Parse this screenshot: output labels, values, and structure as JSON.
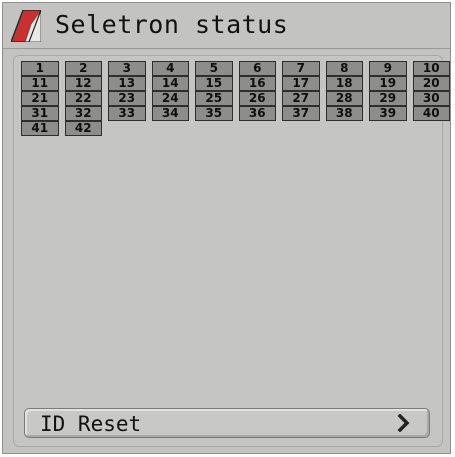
{
  "title": "Seletron status",
  "cells": [
    "1",
    "2",
    "3",
    "4",
    "5",
    "6",
    "7",
    "8",
    "9",
    "10",
    "11",
    "12",
    "13",
    "14",
    "15",
    "16",
    "17",
    "18",
    "19",
    "20",
    "21",
    "22",
    "23",
    "24",
    "25",
    "26",
    "27",
    "28",
    "29",
    "30",
    "31",
    "32",
    "33",
    "34",
    "35",
    "36",
    "37",
    "38",
    "39",
    "40",
    "41",
    "42"
  ],
  "reset_button": {
    "label": "ID Reset",
    "icon": "chevron-right-icon"
  },
  "colors": {
    "cell_fill": "#8d8e8b",
    "background": "#c3c4c1",
    "logo_red": "#c8312f"
  }
}
